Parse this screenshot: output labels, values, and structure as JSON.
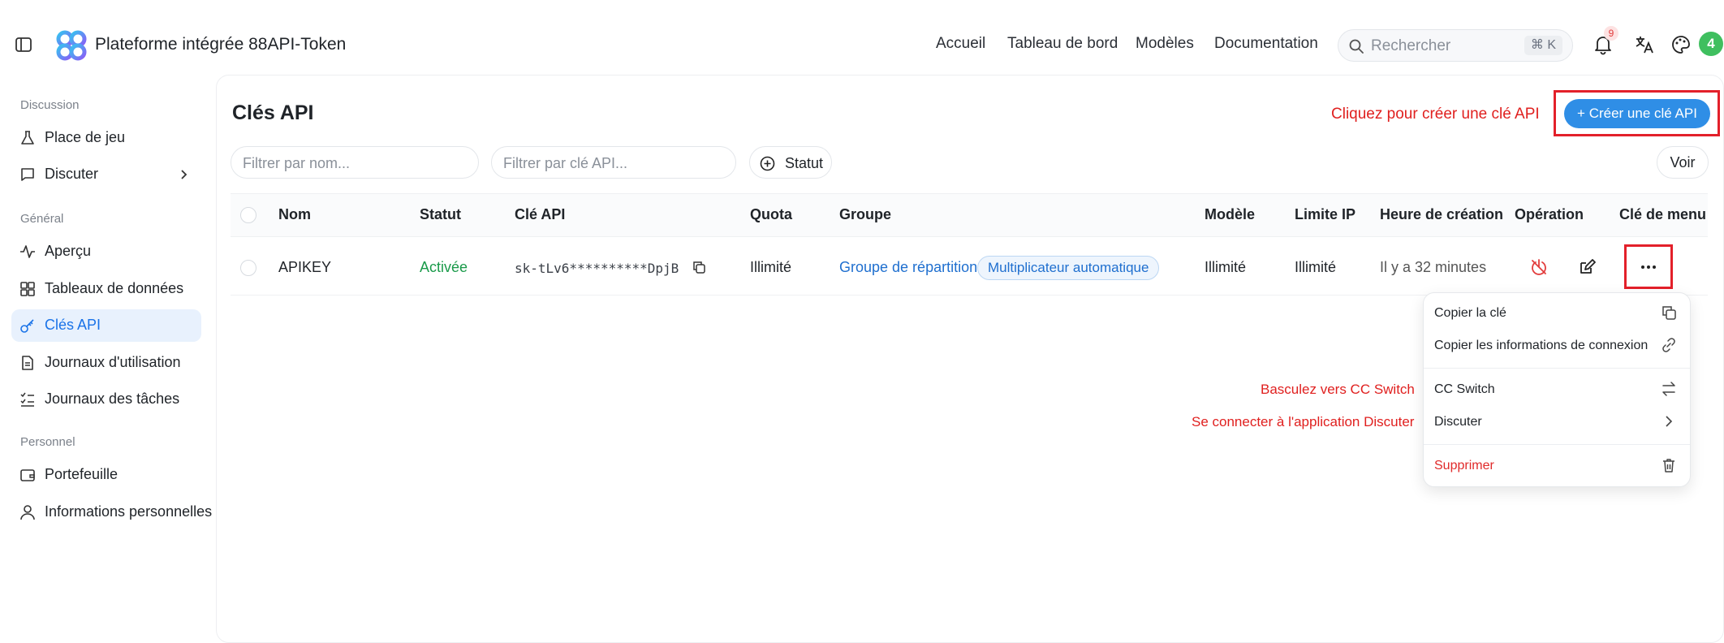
{
  "header": {
    "brand": "Plateforme intégrée 88API-Token",
    "nav": [
      "Accueil",
      "Tableau de bord",
      "Modèles",
      "Documentation"
    ],
    "search_placeholder": "Rechercher",
    "search_shortcut": "⌘ K",
    "notification_count": "9",
    "avatar_letter": "4",
    "icons": [
      "sidebar-toggle-icon",
      "bell-icon",
      "translate-icon",
      "palette-icon"
    ]
  },
  "sidebar": {
    "sections": [
      {
        "title": "Discussion",
        "items": [
          {
            "label": "Place de jeu",
            "icon": "flask-icon"
          },
          {
            "label": "Discuter",
            "icon": "chat-icon"
          }
        ]
      },
      {
        "title": "Général",
        "items": [
          {
            "label": "Aperçu",
            "icon": "activity-icon"
          },
          {
            "label": "Tableaux de données",
            "icon": "grid-icon"
          },
          {
            "label": "Clés API",
            "icon": "key-icon",
            "active": true
          },
          {
            "label": "Journaux d'utilisation",
            "icon": "file-text-icon"
          },
          {
            "label": "Journaux des tâches",
            "icon": "list-check-icon"
          }
        ]
      },
      {
        "title": "Personnel",
        "items": [
          {
            "label": "Portefeuille",
            "icon": "wallet-icon"
          },
          {
            "label": "Informations personnelles",
            "icon": "user-icon"
          }
        ]
      }
    ]
  },
  "page": {
    "title": "Clés API",
    "create_hint": "Cliquez pour créer une clé API",
    "create_button": "+ Créer une clé API",
    "filter_name_placeholder": "Filtrer par nom...",
    "filter_key_placeholder": "Filtrer par clé API...",
    "status_button": "Statut",
    "view_button": "Voir"
  },
  "table": {
    "columns": [
      "Nom",
      "Statut",
      "Clé API",
      "Quota",
      "Groupe",
      "Modèle",
      "Limite IP",
      "Heure de création",
      "Opération",
      "Clé de menu"
    ],
    "rows": [
      {
        "name": "APIKEY",
        "status": "Activée",
        "key": "sk-tLv6**********DpjB",
        "quota": "Illimité",
        "group": "Groupe de répartition",
        "group_tag": "Multiplicateur automatique",
        "model": "Illimité",
        "ip_limit": "Illimité",
        "created": "Il y a 32 minutes"
      }
    ]
  },
  "menu": {
    "items": [
      {
        "label": "Copier la clé",
        "icon": "copy-icon"
      },
      {
        "label": "Copier les informations de connexion",
        "icon": "link-icon"
      },
      {
        "label": "CC Switch",
        "icon": "switch-icon"
      },
      {
        "label": "Discuter",
        "icon": "chevron-right-icon"
      },
      {
        "label": "Supprimer",
        "icon": "trash-icon"
      }
    ]
  },
  "annotations": {
    "switch_hint": "Basculez vers CC Switch",
    "chat_hint": "Se connecter à l'application Discuter"
  },
  "colors": {
    "accent": "#2f8ee6",
    "active_status": "#1a9a4a",
    "annotation": "#e0201f"
  }
}
